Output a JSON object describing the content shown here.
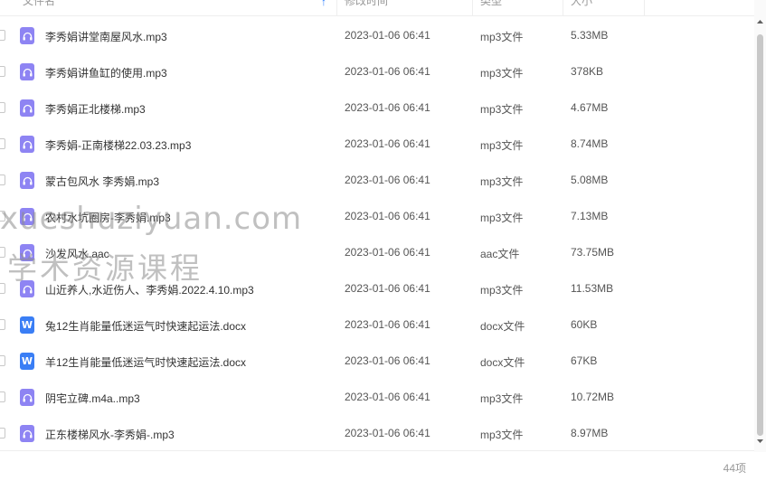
{
  "header": {
    "name_label": "文件名",
    "modified_label": "修改时间",
    "type_label": "类型",
    "size_label": "大小"
  },
  "files": [
    {
      "name": "李秀娟讲堂南屋风水.mp3",
      "date": "2023-01-06 06:41",
      "type": "mp3文件",
      "size": "5.33MB",
      "icon": "audio"
    },
    {
      "name": "李秀娟讲鱼缸的使用.mp3",
      "date": "2023-01-06 06:41",
      "type": "mp3文件",
      "size": "378KB",
      "icon": "audio"
    },
    {
      "name": "李秀娟正北楼梯.mp3",
      "date": "2023-01-06 06:41",
      "type": "mp3文件",
      "size": "4.67MB",
      "icon": "audio"
    },
    {
      "name": "李秀娟-正南楼梯22.03.23.mp3",
      "date": "2023-01-06 06:41",
      "type": "mp3文件",
      "size": "8.74MB",
      "icon": "audio"
    },
    {
      "name": "蒙古包风水 李秀娟.mp3",
      "date": "2023-01-06 06:41",
      "type": "mp3文件",
      "size": "5.08MB",
      "icon": "audio"
    },
    {
      "name": "农村水坑圈房-李秀娟.mp3",
      "date": "2023-01-06 06:41",
      "type": "mp3文件",
      "size": "7.13MB",
      "icon": "audio"
    },
    {
      "name": "沙发风水.aac",
      "date": "2023-01-06 06:41",
      "type": "aac文件",
      "size": "73.75MB",
      "icon": "audio"
    },
    {
      "name": "山近养人,水近伤人、李秀娟.2022.4.10.mp3",
      "date": "2023-01-06 06:41",
      "type": "mp3文件",
      "size": "11.53MB",
      "icon": "audio"
    },
    {
      "name": "兔12生肖能量低迷运气时快速起运法.docx",
      "date": "2023-01-06 06:41",
      "type": "docx文件",
      "size": "60KB",
      "icon": "doc"
    },
    {
      "name": "羊12生肖能量低迷运气时快速起运法.docx",
      "date": "2023-01-06 06:41",
      "type": "docx文件",
      "size": "67KB",
      "icon": "doc"
    },
    {
      "name": "阴宅立碑.m4a..mp3",
      "date": "2023-01-06 06:41",
      "type": "mp3文件",
      "size": "10.72MB",
      "icon": "audio"
    },
    {
      "name": "正东楼梯风水-李秀娟-.mp3",
      "date": "2023-01-06 06:41",
      "type": "mp3文件",
      "size": "8.97MB",
      "icon": "audio"
    }
  ],
  "item_count": "44项",
  "watermark": {
    "line1": "xueshuziyuan.com",
    "line2": "学术资源课程"
  },
  "colors": {
    "audio_icon": "#8e84f3",
    "doc_icon": "#3a7ef5",
    "sort_accent": "#2f80ff"
  }
}
